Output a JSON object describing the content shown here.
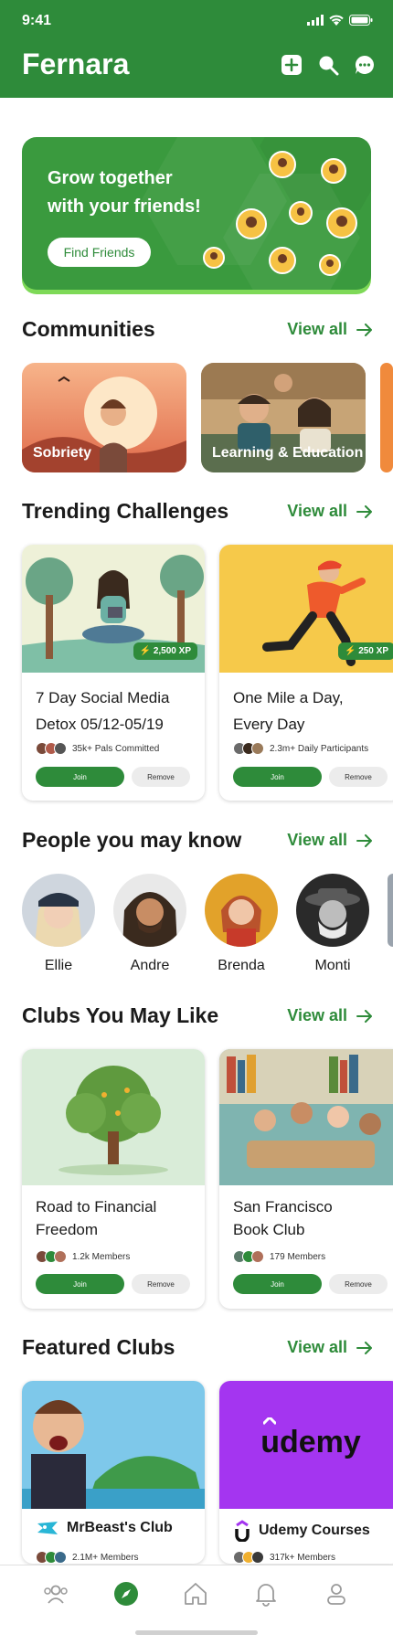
{
  "status": {
    "time": "9:41"
  },
  "app": {
    "title": "Fernara"
  },
  "header_icons": [
    "plus-square-icon",
    "search-icon",
    "chat-bubble-icon"
  ],
  "banner": {
    "line1": "Grow together",
    "line2": "with your friends!",
    "button": "Find Friends"
  },
  "communities": {
    "title": "Communities",
    "view_all": "View all",
    "items": [
      {
        "label": "Sobriety"
      },
      {
        "label": "Learning & Education"
      }
    ]
  },
  "challenges": {
    "title": "Trending Challenges",
    "view_all": "View all",
    "items": [
      {
        "line1": "7 Day Social Media",
        "line2": "Detox 05/12-05/19",
        "xp": "2,500 XP",
        "meta": "35k+ Pals Committed",
        "join": "Join",
        "remove": "Remove"
      },
      {
        "line1": "One Mile a Day,",
        "line2": "Every Day",
        "xp": "250 XP",
        "meta": "2.3m+ Daily Participants",
        "join": "Join",
        "remove": "Remove"
      }
    ]
  },
  "people": {
    "title": "People you may know",
    "view_all": "View all",
    "items": [
      {
        "name": "Ellie"
      },
      {
        "name": "Andre"
      },
      {
        "name": "Brenda"
      },
      {
        "name": "Monti"
      }
    ]
  },
  "clubs": {
    "title": "Clubs You May Like",
    "view_all": "View all",
    "items": [
      {
        "line1": "Road to Financial",
        "line2": "Freedom",
        "meta": "1.2k Members",
        "join": "Join",
        "remove": "Remove"
      },
      {
        "line1": "San Francisco",
        "line2": "Book Club",
        "meta": "179 Members",
        "join": "Join",
        "remove": "Remove"
      }
    ]
  },
  "featured": {
    "title": "Featured Clubs",
    "view_all": "View all",
    "items": [
      {
        "name": "MrBeast's Club",
        "meta": "2.1M+ Members"
      },
      {
        "name": "Udemy Courses",
        "meta": "317k+ Members",
        "logo": "udemy"
      }
    ]
  },
  "colors": {
    "brand": "#2e8b3a",
    "accent": "#7ed957",
    "udemy": "#a435f0"
  },
  "bottom_nav": [
    "people-icon",
    "compass-icon",
    "home-icon",
    "bell-icon",
    "profile-icon"
  ]
}
